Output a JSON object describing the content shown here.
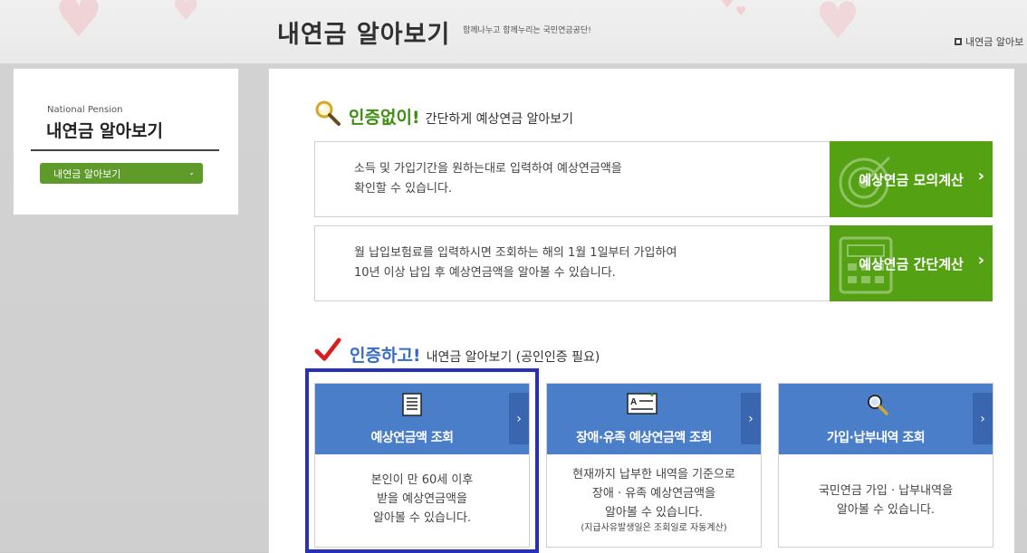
{
  "header": {
    "title": "내연금 알아보기",
    "slogan": "함께나누고 함께누리는 국민연금공단!",
    "right_link": "내연금 알아보"
  },
  "sidebar": {
    "small_title": "National Pension",
    "title": "내연금 알아보기",
    "select_value": "내연금 알아보기"
  },
  "section1": {
    "emphasis": "인증없이!",
    "rest": "간단하게 예상연금 알아보기",
    "items": [
      {
        "text_line1": "소득 및 가입기간을 원하는대로 입력하여 예상연금액을",
        "text_line2": "확인할 수 있습니다.",
        "button": "예상연금 모의계산"
      },
      {
        "text_line1": "월 납입보험료를 입력하시면 조회하는 해의 1월 1일부터 가입하여",
        "text_line2": "10년 이상 납입 후 예상연금액을 알아볼 수 있습니다.",
        "button": "예상연금 간단계산"
      }
    ]
  },
  "section2": {
    "emphasis": "인증하고!",
    "rest": "내연금 알아보기 (공인인증 필요)",
    "cards": [
      {
        "title": "예상연금액 조회",
        "line1": "본인이 만 60세 이후",
        "line2": "받을 예상연금액을",
        "line3": "알아볼 수 있습니다.",
        "note": ""
      },
      {
        "title": "장애·유족 예상연금액 조회",
        "line1": "현재까지 납부한 내역을 기준으로",
        "line2": "장애 · 유족 예상연금액을",
        "line3": "알아볼 수 있습니다.",
        "note": "(지급사유발생일은 조회일로 자동계산)"
      },
      {
        "title": "가입·납부내역 조회",
        "line1": "국민연금 가입 · 납부내역을",
        "line2": "알아볼 수 있습니다.",
        "line3": "",
        "note": ""
      }
    ]
  },
  "icons": {
    "search": "magnifier-icon",
    "check": "check-icon",
    "chevron": "›",
    "chevron_small": "⌄"
  },
  "colors": {
    "green": "#54a114",
    "blue": "#4b7ec9",
    "blue_dark": "#3a66b0",
    "highlight": "#2630b8",
    "sidebar_green": "#5e9b2b"
  }
}
